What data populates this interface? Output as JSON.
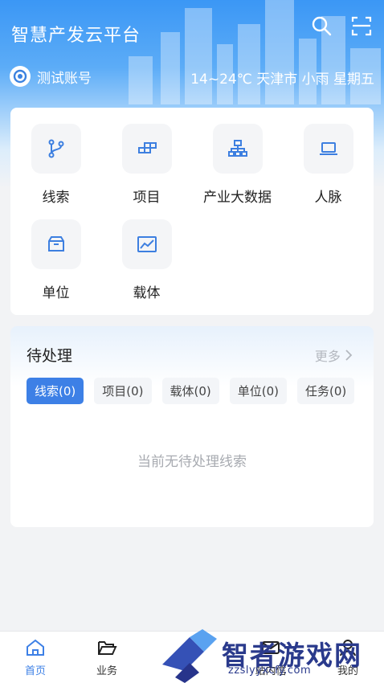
{
  "header": {
    "title": "智慧产发云平台",
    "account_name": "测试账号",
    "weather": "14~24℃ 天津市 小雨 星期五"
  },
  "icons": {
    "search": "search-icon",
    "scan": "scan-icon"
  },
  "menu": {
    "items": [
      {
        "label": "线索",
        "icon": "branch-icon"
      },
      {
        "label": "项目",
        "icon": "blocks-icon"
      },
      {
        "label": "产业大数据",
        "icon": "org-chart-icon"
      },
      {
        "label": "人脉",
        "icon": "laptop-icon"
      },
      {
        "label": "单位",
        "icon": "box-icon"
      },
      {
        "label": "载体",
        "icon": "chart-icon"
      }
    ]
  },
  "pending": {
    "title": "待处理",
    "more": "更多",
    "tabs": [
      "线索(0)",
      "项目(0)",
      "载体(0)",
      "单位(0)",
      "任务(0)"
    ],
    "active_tab": 0,
    "empty_text": "当前无待处理线索"
  },
  "tabbar": {
    "items": [
      {
        "label": "首页",
        "icon": "home-icon"
      },
      {
        "label": "业务",
        "icon": "folder-icon"
      },
      {
        "label": "站内信",
        "icon": "message-icon"
      },
      {
        "label": "我的",
        "icon": "user-icon"
      }
    ],
    "active": 0
  },
  "watermark": {
    "text": "智者游戏网",
    "url": "zzslyyxcfy.com"
  },
  "colors": {
    "accent": "#3d80e6",
    "header_blue": "#3b97f5",
    "icon_blue": "#3d7fe0"
  }
}
